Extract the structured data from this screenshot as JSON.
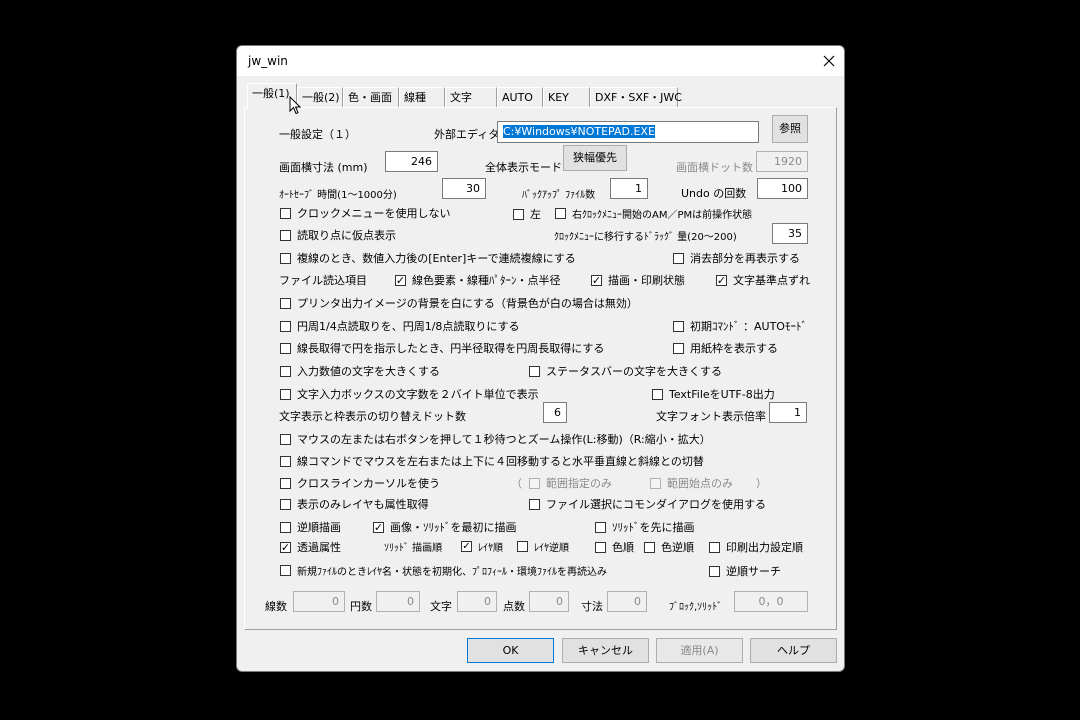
{
  "window": {
    "title": "jw_win"
  },
  "tabs": [
    "一般(1)",
    "一般(2)",
    "色・画面",
    "線種",
    "文字",
    "AUTO",
    "KEY",
    "DXF・SXF・JWC"
  ],
  "general": {
    "heading": "一般設定（１）",
    "editor_label": "外部エディタ",
    "editor_value": "C:¥Windows¥NOTEPAD.EXE",
    "browse_button": "参照",
    "screen_size_label": "画面横寸法 (mm)",
    "screen_size_value": "246",
    "fullview_label": "全体表示モード",
    "fullview_button": "狭幅優先",
    "screen_dots_label": "画面横ドット数",
    "screen_dots_value": "1920",
    "autosave_label": "ｵｰﾄｾｰﾌﾞ 時間(1〜1000分)",
    "autosave_value": "30",
    "backup_label": "ﾊﾞｯｸｱｯﾌﾟ ﾌｧｲﾙ数",
    "backup_value": "1",
    "undo_label": "Undo の回数",
    "undo_value": "100",
    "drag_label": "ｸﾛｯｸﾒﾆｭｰに移行するﾄﾞﾗｯｸﾞ 量(20〜200)",
    "drag_value": "35",
    "file_items_label": "ファイル読込項目",
    "dot_switch_label": "文字表示と枠表示の切り替えドット数",
    "dot_switch_value": "6",
    "font_scale_label": "文字フォント表示倍率",
    "font_scale_value": "1",
    "solid_order_label": "ｿﾘｯﾄﾞ 描画順",
    "range_paren_open": "（",
    "range_paren_close": "）"
  },
  "checkboxes": {
    "clock_menu_off": {
      "label": "クロックメニューを使用しない",
      "checked": false
    },
    "left": {
      "label": "左",
      "checked": false
    },
    "right_clock": {
      "label": "右ｸﾛｯｸﾒﾆｭｰ開始のAM／PMは前操作状態",
      "checked": false
    },
    "temp_point": {
      "label": "読取り点に仮点表示",
      "checked": false
    },
    "double_line": {
      "label": "複線のとき、数値入力後の[Enter]キーで連続複線にする",
      "checked": false
    },
    "redraw_erase": {
      "label": "消去部分を再表示する",
      "checked": false
    },
    "line_color": {
      "label": "線色要素・線種ﾊﾟﾀｰﾝ・点半径",
      "checked": true
    },
    "print_state": {
      "label": "描画・印刷状態",
      "checked": true
    },
    "text_base": {
      "label": "文字基準点ずれ",
      "checked": true
    },
    "printer_white": {
      "label": "プリンタ出力イメージの背景を白にする（背景色が白の場合は無効）",
      "checked": false
    },
    "circle_quarter": {
      "label": "円周1/4点読取りを、円周1/8点読取りにする",
      "checked": false
    },
    "init_auto": {
      "label": "初期ｺﾏﾝﾄﾞ ：AUTOﾓｰﾄﾞ",
      "checked": false
    },
    "line_length": {
      "label": "線長取得で円を指示したとき、円半径取得を円周長取得にする",
      "checked": false
    },
    "paper_frame": {
      "label": "用紙枠を表示する",
      "checked": false
    },
    "big_input": {
      "label": "入力数値の文字を大きくする",
      "checked": false
    },
    "big_status": {
      "label": "ステータスバーの文字を大きくする",
      "checked": false
    },
    "two_byte": {
      "label": "文字入力ボックスの文字数を２バイト単位で表示",
      "checked": false
    },
    "utf8": {
      "label": "TextFileをUTF-8出力",
      "checked": false
    },
    "mouse_zoom": {
      "label": "マウスの左または右ボタンを押して１秒待つとズーム操作(L:移動)（R:縮小・拡大）",
      "checked": false
    },
    "line_cmd": {
      "label": "線コマンドでマウスを左右または上下に４回移動すると水平垂直線と斜線との切替",
      "checked": false
    },
    "crossline": {
      "label": "クロスラインカーソルを使う",
      "checked": false
    },
    "range_only": {
      "label": "範囲指定のみ",
      "checked": false
    },
    "range_start": {
      "label": "範囲始点のみ",
      "checked": false
    },
    "layer_attr": {
      "label": "表示のみレイヤも属性取得",
      "checked": false
    },
    "common_dialog": {
      "label": "ファイル選択にコモンダイアログを使用する",
      "checked": false
    },
    "reverse_draw": {
      "label": "逆順描画",
      "checked": false
    },
    "image_first": {
      "label": "画像・ｿﾘｯﾄﾞを最初に描画",
      "checked": true
    },
    "solid_first": {
      "label": "ｿﾘｯﾄﾞを先に描画",
      "checked": false
    },
    "transparent": {
      "label": "透過属性",
      "checked": true
    },
    "layer_order": {
      "label": "ﾚｲﾔ順",
      "checked": true
    },
    "layer_reverse": {
      "label": "ﾚｲﾔ逆順",
      "checked": false
    },
    "color_order": {
      "label": "色順",
      "checked": false
    },
    "color_reverse": {
      "label": "色逆順",
      "checked": false
    },
    "print_output": {
      "label": "印刷出力設定順",
      "checked": false
    },
    "new_file": {
      "label": "新規ﾌｧｲﾙのときﾚｲﾔ名・状態を初期化、ﾌﾟﾛﾌｨｰﾙ・環境ﾌｧｲﾙを再読込み",
      "checked": false
    },
    "reverse_search": {
      "label": "逆順サーチ",
      "checked": false
    }
  },
  "counts": {
    "lines_label": "線数",
    "lines_value": "0",
    "circles_label": "円数",
    "circles_value": "0",
    "text_label": "文字",
    "text_value": "0",
    "points_label": "点数",
    "points_value": "0",
    "dims_label": "寸法",
    "dims_value": "0",
    "block_label": "ﾌﾞﾛｯｸ,ｿﾘｯﾄﾞ",
    "block_value": "0，0"
  },
  "footer": {
    "ok": "OK",
    "cancel": "キャンセル",
    "apply": "適用(A)",
    "help": "ヘルプ"
  }
}
